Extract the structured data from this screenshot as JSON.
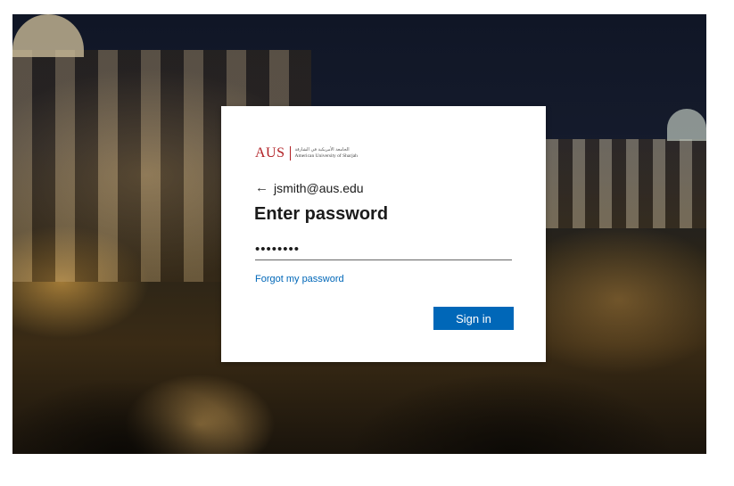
{
  "logo": {
    "abbr": "AUS",
    "arabic": "الجامعة الأمريكية في الشارقة",
    "english": "American University of Sharjah"
  },
  "account": {
    "back_icon": "←",
    "email": "jsmith@aus.edu"
  },
  "page": {
    "title": "Enter password"
  },
  "password": {
    "value": "••••••••"
  },
  "links": {
    "forgot": "Forgot my password"
  },
  "buttons": {
    "sign_in": "Sign in"
  },
  "colors": {
    "brand_red": "#b11f24",
    "primary_blue": "#0067b8"
  }
}
